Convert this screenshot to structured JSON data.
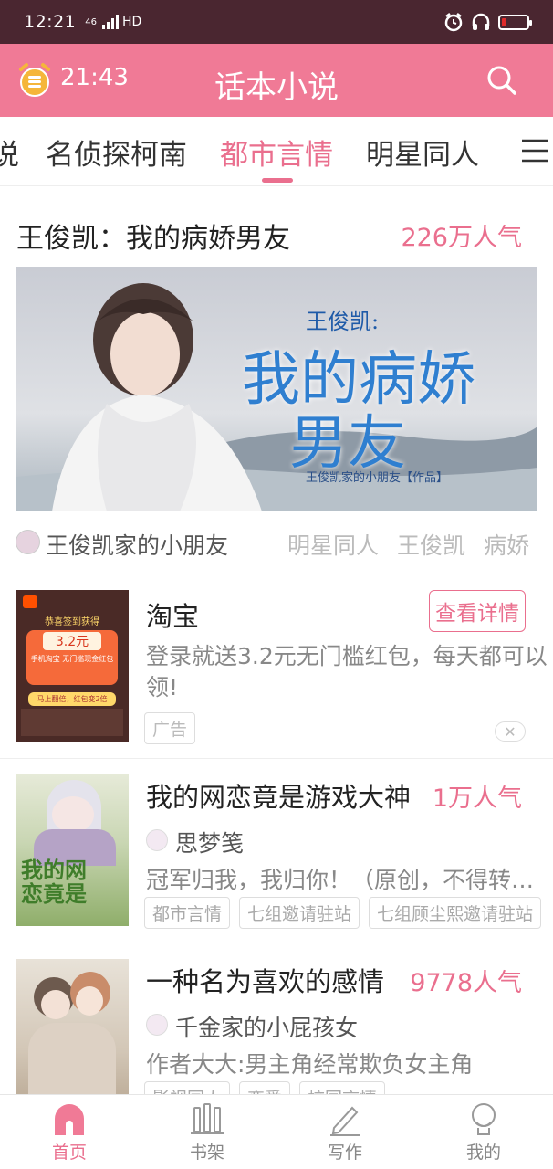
{
  "status_bar": {
    "time": "12:21",
    "network": "46",
    "hd": "HD"
  },
  "header": {
    "timer": "21:43",
    "title": "话本小说"
  },
  "tabs": [
    {
      "label": "说"
    },
    {
      "label": "名侦探柯南"
    },
    {
      "label": "都市言情"
    },
    {
      "label": "明星同人"
    }
  ],
  "featured": {
    "title": "王俊凯：我的病娇男友",
    "popularity": "226万人气",
    "author": "王俊凯家的小朋友",
    "tags": [
      "明星同人",
      "王俊凯",
      "病娇"
    ],
    "banner": {
      "small_title": "王俊凯:",
      "big_title_1": "我的病娇",
      "big_title_2": "男友",
      "credit": "王俊凯家的小朋友【作品】"
    }
  },
  "ad": {
    "name": "淘宝",
    "button": "查看详情",
    "desc": "登录就送3.2元无门槛红包，每天都可以领!",
    "badge": "广告",
    "close": "✕",
    "cover_top": "恭喜签到获得",
    "cover_amount": "3.2元",
    "cover_line": "手机淘宝 无门槛现金红包",
    "cover_btn": "马上翻倍，红包变2倍"
  },
  "list": [
    {
      "name": "我的网恋竟是游戏大神",
      "popularity": "1万人气",
      "author": "思梦笺",
      "desc": "冠军归我，我归你！（原创，不得转载）",
      "tags": [
        "都市言情",
        "七组邀请驻站",
        "七组顾尘熙邀请驻站"
      ],
      "cover_text": "我的网恋竟是"
    },
    {
      "name": "一种名为喜欢的感情",
      "popularity": "9778人气",
      "author": "千金家的小屁孩女",
      "desc": "作者大大:男主角经常欺负女主角",
      "tags": [
        "影视同人",
        "恋爱",
        "校园言情"
      ]
    }
  ],
  "bottom_nav": [
    {
      "label": "首页",
      "icon": "home-icon"
    },
    {
      "label": "书架",
      "icon": "bookshelf-icon"
    },
    {
      "label": "写作",
      "icon": "pen-icon"
    },
    {
      "label": "我的",
      "icon": "profile-icon"
    }
  ],
  "colors": {
    "accent": "#ea6f8e",
    "header": "#f07a96",
    "status_bar": "#4a2630"
  }
}
